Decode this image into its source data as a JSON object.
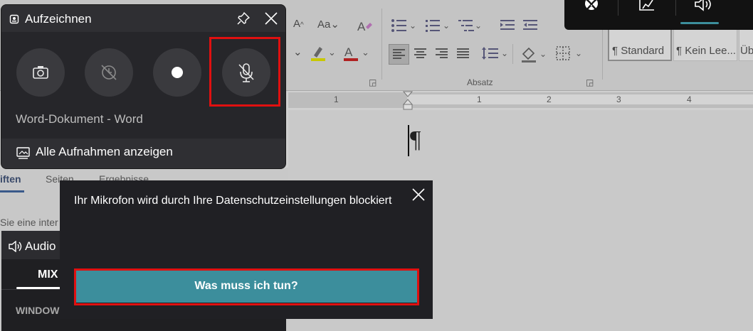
{
  "word": {
    "paragraph_group": "Absatz",
    "styles": [
      "¶ Standard",
      "¶ Kein Lee...",
      "Üb"
    ],
    "ruler_numbers": [
      "1",
      "1",
      "2",
      "3",
      "4"
    ],
    "pilcrow": "¶",
    "pane_tabs": [
      "iften",
      "Seiten",
      "Ergebnisse"
    ],
    "pane_hint": "Sie eine inter"
  },
  "capture": {
    "title": "Aufzeichnen",
    "source": "Word-Dokument - Word",
    "show_all": "Alle Aufnahmen anzeigen"
  },
  "audio": {
    "title": "Audio",
    "tab_mix": "MIX",
    "section": "WINDOWS"
  },
  "notification": {
    "message": "Ihr Mikrofon wird durch Ihre Datenschutzeinstellungen blockiert",
    "button": "Was muss ich tun?"
  },
  "colors": {
    "accent": "#3c8e9c",
    "highlight": "#e01010",
    "panel": "#26262a"
  }
}
